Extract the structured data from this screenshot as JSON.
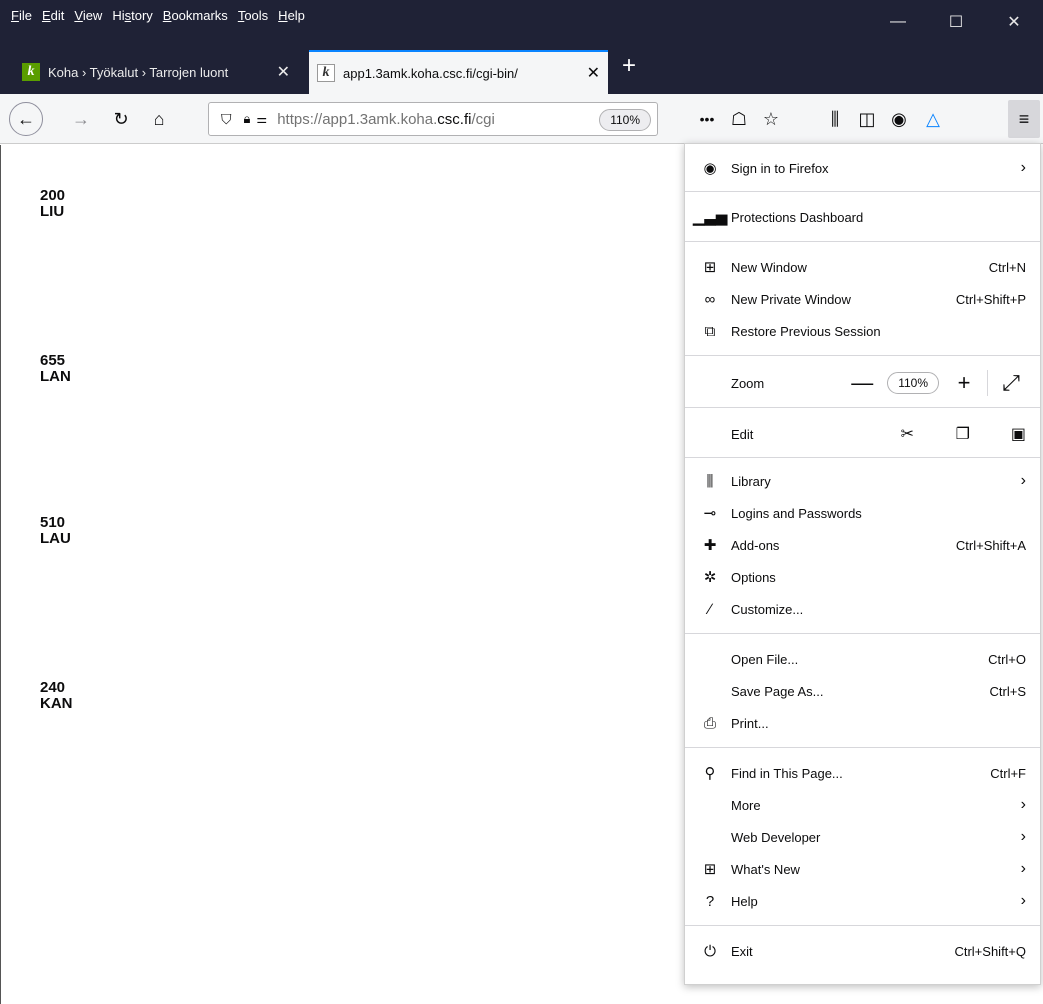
{
  "menubar": {
    "items": [
      "File",
      "Edit",
      "View",
      "History",
      "Bookmarks",
      "Tools",
      "Help"
    ],
    "underline": [
      "F",
      "E",
      "V",
      "s",
      "B",
      "T",
      "H"
    ]
  },
  "window_controls": {
    "minimize": "—",
    "maximize": "☐",
    "close": "✕"
  },
  "tabs": [
    {
      "title": "Koha › Työkalut › Tarrojen luont",
      "favicon": "k",
      "active": false
    },
    {
      "title": "app1.3amk.koha.csc.fi/cgi-bin/",
      "favicon": "k",
      "active": true
    }
  ],
  "new_tab": "+",
  "navbar": {
    "url_prefix": "https://app1.3amk.koha.",
    "url_domain": "csc.fi",
    "url_suffix": "/cgi",
    "zoom": "110%"
  },
  "page": {
    "labels": [
      {
        "line1": "200",
        "line2": "LIU"
      },
      {
        "line1": "655",
        "line2": "LAN"
      },
      {
        "line1": "510",
        "line2": "LAU"
      },
      {
        "line1": "240",
        "line2": "KAN"
      }
    ]
  },
  "app_menu": {
    "sign_in": "Sign in to Firefox",
    "protections": "Protections Dashboard",
    "new_window": {
      "label": "New Window",
      "accel": "Ctrl+N"
    },
    "new_private": {
      "label": "New Private Window",
      "accel": "Ctrl+Shift+P"
    },
    "restore": "Restore Previous Session",
    "zoom": {
      "label": "Zoom",
      "minus": "—",
      "value": "110%",
      "plus": "+",
      "fullscreen": "⤢"
    },
    "edit": {
      "label": "Edit"
    },
    "library": "Library",
    "logins": "Logins and Passwords",
    "addons": {
      "label": "Add-ons",
      "accel": "Ctrl+Shift+A"
    },
    "options": "Options",
    "customize": "Customize...",
    "open_file": {
      "label": "Open File...",
      "accel": "Ctrl+O"
    },
    "save_page": {
      "label": "Save Page As...",
      "accel": "Ctrl+S"
    },
    "print": "Print...",
    "find": {
      "label": "Find in This Page...",
      "accel": "Ctrl+F"
    },
    "more": "More",
    "web_dev": "Web Developer",
    "whats_new": "What's New",
    "help": "Help",
    "exit": {
      "label": "Exit",
      "accel": "Ctrl+Shift+Q"
    }
  }
}
